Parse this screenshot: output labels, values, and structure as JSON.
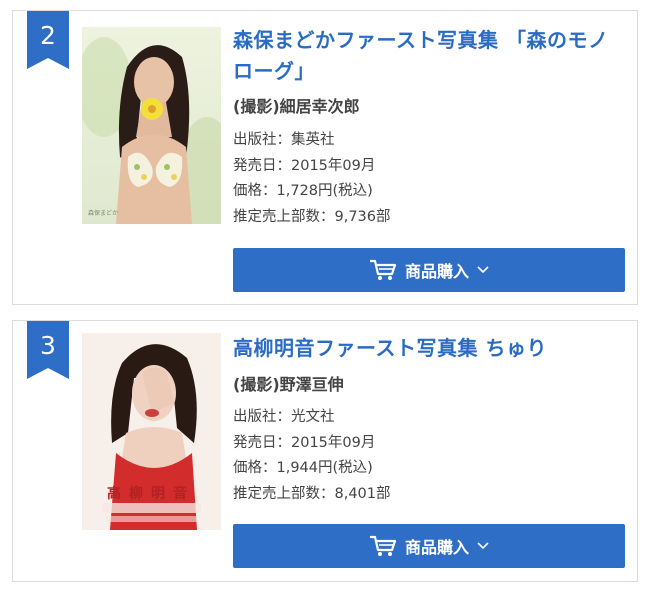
{
  "colors": {
    "accent": "#2e6ec6",
    "title": "#2a6cc4",
    "border": "#dcdcdc"
  },
  "items": [
    {
      "rank": "2",
      "title_line1": "森保まどかファースト写真集 「森のモノ",
      "title_line2": "ローグ」",
      "photographer": "(撮影)細居幸次郎",
      "publisher": "出版社：集英社",
      "release": "発売日：2015年09月",
      "price": "価格：1,728円(税込)",
      "sales": "推定売上部数：9,736部",
      "buy_label": "商品購入",
      "icons": [
        "cart-icon",
        "chevron-down-icon"
      ]
    },
    {
      "rank": "3",
      "title_line1": "高柳明音ファースト写真集 ちゅり",
      "title_line2": "",
      "photographer": "(撮影)野澤亘伸",
      "publisher": "出版社：光文社",
      "release": "発売日：2015年09月",
      "price": "価格：1,944円(税込)",
      "sales": "推定売上部数：8,401部",
      "buy_label": "商品購入",
      "cover_text": "高柳明音",
      "icons": [
        "cart-icon",
        "chevron-down-icon"
      ]
    }
  ]
}
